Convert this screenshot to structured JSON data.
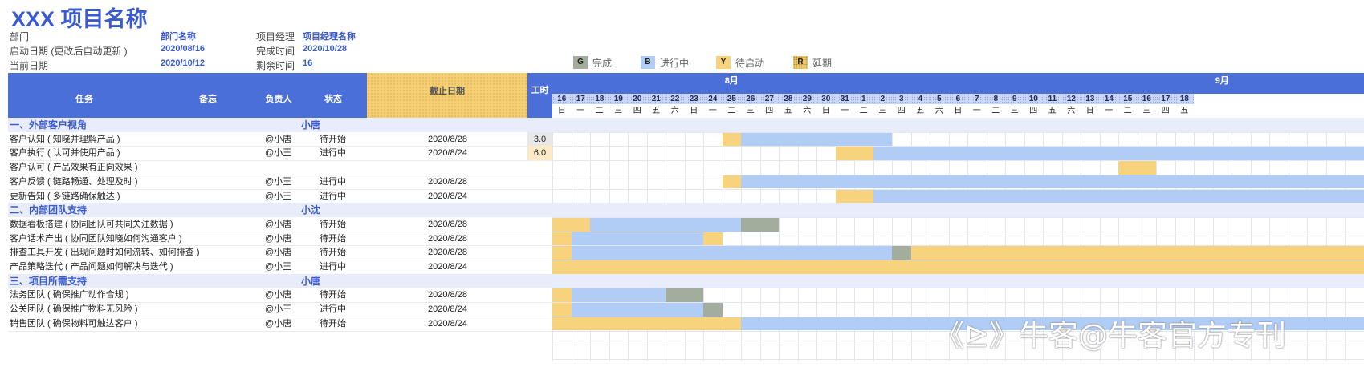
{
  "title": "XXX 项目名称",
  "meta": {
    "dept_label": "部门",
    "dept_value": "部门名称",
    "pm_label": "项目经理",
    "pm_value": "项目经理名称",
    "start_label": "启动日期 (更改后自动更新 )",
    "start_value": "2020/08/16",
    "finish_label": "完成时间",
    "finish_value": "2020/10/28",
    "today_label": "当前日期",
    "today_value": "2020/10/12",
    "remain_label": "剩余时间",
    "remain_value": "16"
  },
  "legend": [
    {
      "key": "G",
      "label": "完成",
      "color": "#a3ad9e"
    },
    {
      "key": "B",
      "label": "进行中",
      "color": "#b1cdf6"
    },
    {
      "key": "Y",
      "label": "待启动",
      "color": "#f6d37c"
    },
    {
      "key": "R",
      "label": "延期",
      "color": "#e8c76d"
    }
  ],
  "headers": {
    "task": "任务",
    "note": "备忘",
    "owner": "负责人",
    "status": "状态",
    "due": "截止日期",
    "hours": "工时"
  },
  "months": [
    {
      "label": "8月",
      "col": 9
    },
    {
      "label": "9月",
      "col": 35
    }
  ],
  "days": [
    "16",
    "17",
    "18",
    "19",
    "20",
    "21",
    "22",
    "23",
    "24",
    "25",
    "26",
    "27",
    "28",
    "29",
    "30",
    "31",
    "1",
    "2",
    "3",
    "4",
    "5",
    "6",
    "7",
    "8",
    "9",
    "10",
    "11",
    "12",
    "13",
    "14",
    "15",
    "16",
    "17",
    "18"
  ],
  "weekdays": [
    "日",
    "一",
    "二",
    "三",
    "四",
    "五",
    "六",
    "日",
    "一",
    "二",
    "三",
    "四",
    "五",
    "六",
    "日",
    "一",
    "二",
    "三",
    "四",
    "五",
    "六",
    "日",
    "一",
    "二",
    "三",
    "四",
    "五",
    "六",
    "日",
    "一",
    "二",
    "三",
    "四",
    "五"
  ],
  "rows": [
    {
      "type": "section",
      "title": "一、外部客户视角",
      "lead": "小唐"
    },
    {
      "type": "task",
      "name": "客户认知 ( 知晓并理解产品 )",
      "owner": "@小唐",
      "status": "待开始",
      "due": "2020/8/28",
      "hours": "3.0",
      "bars": [
        {
          "c": "y",
          "s": 9,
          "e": 10
        },
        {
          "c": "b",
          "s": 10,
          "e": 18
        }
      ]
    },
    {
      "type": "task",
      "name": "客户执行 ( 认可并使用产品 )",
      "owner": "@小王",
      "status": "进行中",
      "due": "2020/8/24",
      "hours": "6.0",
      "bars": [
        {
          "c": "y",
          "s": 15,
          "e": 17
        },
        {
          "c": "b",
          "s": 17,
          "e": 43
        }
      ]
    },
    {
      "type": "task",
      "name": "客户认可 ( 产品效果有正向效果 )",
      "owner": "",
      "status": "",
      "due": "",
      "hours": "",
      "bars": [
        {
          "c": "y",
          "s": 30,
          "e": 32
        }
      ]
    },
    {
      "type": "task",
      "name": "客户反馈 ( 链路畅通、处理及时 )",
      "owner": "@小王",
      "status": "进行中",
      "due": "2020/8/28",
      "hours": "",
      "bars": [
        {
          "c": "y",
          "s": 9,
          "e": 10
        },
        {
          "c": "b",
          "s": 10,
          "e": 43
        }
      ]
    },
    {
      "type": "task",
      "name": "更新告知 ( 多链路确保触达 )",
      "owner": "@小王",
      "status": "进行中",
      "due": "2020/8/24",
      "hours": "",
      "bars": [
        {
          "c": "y",
          "s": 15,
          "e": 17
        },
        {
          "c": "b",
          "s": 17,
          "e": 43
        }
      ]
    },
    {
      "type": "section",
      "title": "二、内部团队支持",
      "lead": "小沈"
    },
    {
      "type": "task",
      "name": "数据看板搭建 ( 协同团队可共同关注数据 )",
      "owner": "@小唐",
      "status": "待开始",
      "due": "2020/8/28",
      "hours": "",
      "bars": [
        {
          "c": "y",
          "s": 0,
          "e": 2
        },
        {
          "c": "b",
          "s": 2,
          "e": 10
        },
        {
          "c": "g",
          "s": 10,
          "e": 12
        }
      ]
    },
    {
      "type": "task",
      "name": "客户话术产出 ( 协同团队知晓如何沟通客户 )",
      "owner": "@小唐",
      "status": "待开始",
      "due": "2020/8/28",
      "hours": "",
      "bars": [
        {
          "c": "y",
          "s": 0,
          "e": 1
        },
        {
          "c": "b",
          "s": 1,
          "e": 8
        },
        {
          "c": "y",
          "s": 8,
          "e": 9
        }
      ]
    },
    {
      "type": "task",
      "name": "排查工具开发 ( 出现问题时如何流转、如何排查 )",
      "owner": "@小唐",
      "status": "待开始",
      "due": "2020/8/28",
      "hours": "",
      "bars": [
        {
          "c": "y",
          "s": 0,
          "e": 1
        },
        {
          "c": "b",
          "s": 1,
          "e": 18
        },
        {
          "c": "g",
          "s": 18,
          "e": 19
        },
        {
          "c": "y",
          "s": 19,
          "e": 43
        }
      ]
    },
    {
      "type": "task",
      "name": "产品策略迭代 ( 产品问题如何解决与迭代 )",
      "owner": "@小王",
      "status": "进行中",
      "due": "2020/8/24",
      "hours": "",
      "bars": [
        {
          "c": "y",
          "s": 0,
          "e": 43
        }
      ]
    },
    {
      "type": "section",
      "title": "三、项目所需支持",
      "lead": "小唐"
    },
    {
      "type": "task",
      "name": "法务团队 ( 确保推广动作合规 )",
      "owner": "@小唐",
      "status": "待开始",
      "due": "2020/8/28",
      "hours": "",
      "bars": [
        {
          "c": "y",
          "s": 0,
          "e": 1
        },
        {
          "c": "b",
          "s": 1,
          "e": 6
        },
        {
          "c": "g",
          "s": 6,
          "e": 8
        }
      ]
    },
    {
      "type": "task",
      "name": "公关团队 ( 确保推广物料无风险 )",
      "owner": "@小王",
      "status": "进行中",
      "due": "2020/8/24",
      "hours": "",
      "bars": [
        {
          "c": "y",
          "s": 0,
          "e": 1
        },
        {
          "c": "b",
          "s": 1,
          "e": 8
        },
        {
          "c": "g",
          "s": 8,
          "e": 9
        }
      ]
    },
    {
      "type": "task",
      "name": "销售团队 ( 确保物料可触达客户 )",
      "owner": "@小唐",
      "status": "待开始",
      "due": "2020/8/24",
      "hours": "",
      "bars": [
        {
          "c": "y",
          "s": 0,
          "e": 10
        },
        {
          "c": "b",
          "s": 10,
          "e": 43
        }
      ]
    }
  ],
  "watermark": "牛客@牛客官方专刊"
}
